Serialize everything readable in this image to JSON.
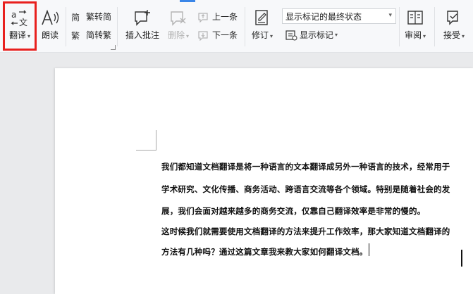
{
  "ribbon": {
    "translate_label": "翻译",
    "read_aloud_label": "朗读",
    "trad_to_simp_label": "繁转简",
    "simp_to_trad_label": "简转繁",
    "insert_comment_label": "插入批注",
    "delete_label": "删除",
    "prev_label": "上一条",
    "next_label": "下一条",
    "track_changes_label": "修订",
    "markup_view_value": "显示标记的最终状态",
    "show_markup_label": "显示标记",
    "review_label": "审阅",
    "accept_label": "接受"
  },
  "document": {
    "lines": [
      "我们都知道文档翻译是将一种语言的文本翻译成另外一种语言的技术，经常用于",
      "学术研究、文化传播、商务活动、跨语言交流等各个领域。特别是随着社会的发",
      "展，我们会面对越来越多的商务交流，仅靠自己翻译效率是非常的慢的。",
      "这时候我们就需要使用文档翻译的方法来提升工作效率，那大家知道文档翻译的",
      "方法有几种吗？通过这篇文章我来教大家如何翻译文档。"
    ]
  },
  "colors": {
    "highlight": "#e8201e",
    "accent": "#3a86e8",
    "ribbon_bg": "#f7f8fa",
    "workspace_bg": "#e9eaec",
    "disabled_text": "#b3b3b3"
  },
  "icons": [
    "translate-icon",
    "read-aloud-icon",
    "trad-to-simp-icon",
    "simp-to-trad-icon",
    "insert-comment-icon",
    "delete-comment-icon",
    "prev-comment-icon",
    "next-comment-icon",
    "track-changes-icon",
    "show-markup-icon",
    "review-icon",
    "accept-icon"
  ]
}
